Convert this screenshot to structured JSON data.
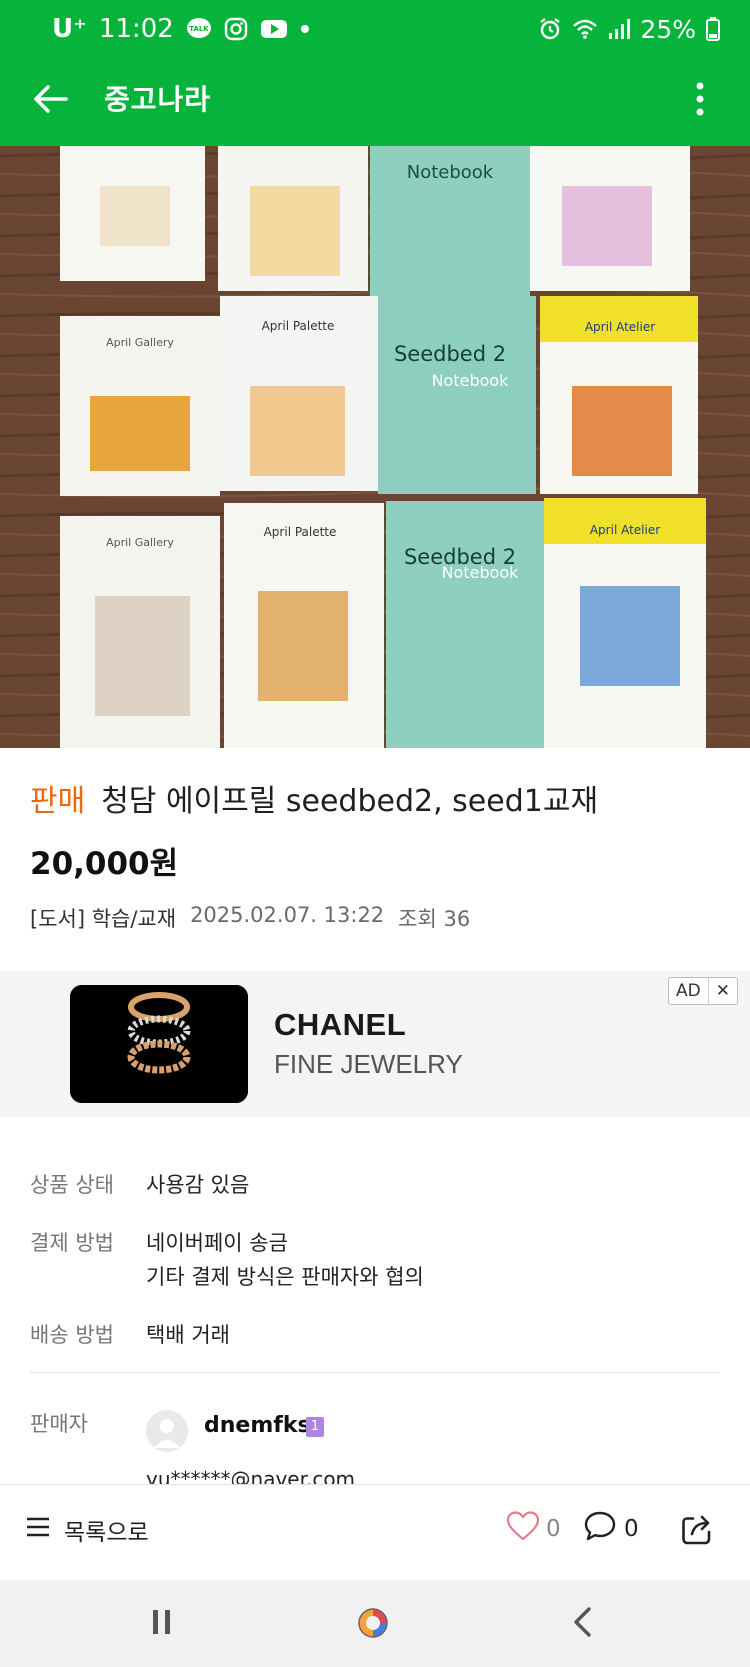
{
  "status_bar": {
    "carrier": "U⁺",
    "time": "11:02",
    "battery": "25%",
    "icons": [
      "talk-icon",
      "instagram-icon",
      "youtube-icon",
      "dot-icon",
      "alarm-icon",
      "wifi-icon",
      "signal-icon",
      "battery-icon"
    ]
  },
  "app_bar": {
    "title": "중고나라",
    "back_icon": "arrow-left-icon",
    "menu_icon": "more-vertical-icon"
  },
  "product": {
    "badge": "판매",
    "title": "청담 에이프릴 seedbed2, seed1교재",
    "price": "20,000원",
    "category": "[도서] 학습/교재",
    "date": "2025.02.07. 13:22",
    "views": "조회 36"
  },
  "ad": {
    "label": "AD",
    "close": "✕",
    "brand": "CHANEL",
    "subtitle": "FINE JEWELRY"
  },
  "info": {
    "condition_label": "상품 상태",
    "condition_value": "사용감 있음",
    "payment_label": "결제 방법",
    "payment_value_1": "네이버페이 송금",
    "payment_value_2": "기타 결제 방식은 판매자와 협의",
    "shipping_label": "배송 방법",
    "shipping_value": "택배 거래"
  },
  "seller": {
    "label": "판매자",
    "name": "dnemfks",
    "level": "1",
    "email": "yu******@naver.com"
  },
  "bottom_bar": {
    "list_label": "목록으로",
    "like_count": "0",
    "comment_count": "0"
  },
  "colors": {
    "brand_green": "#06b33b",
    "badge_orange": "#e8690f",
    "level_purple": "#b085e0"
  }
}
